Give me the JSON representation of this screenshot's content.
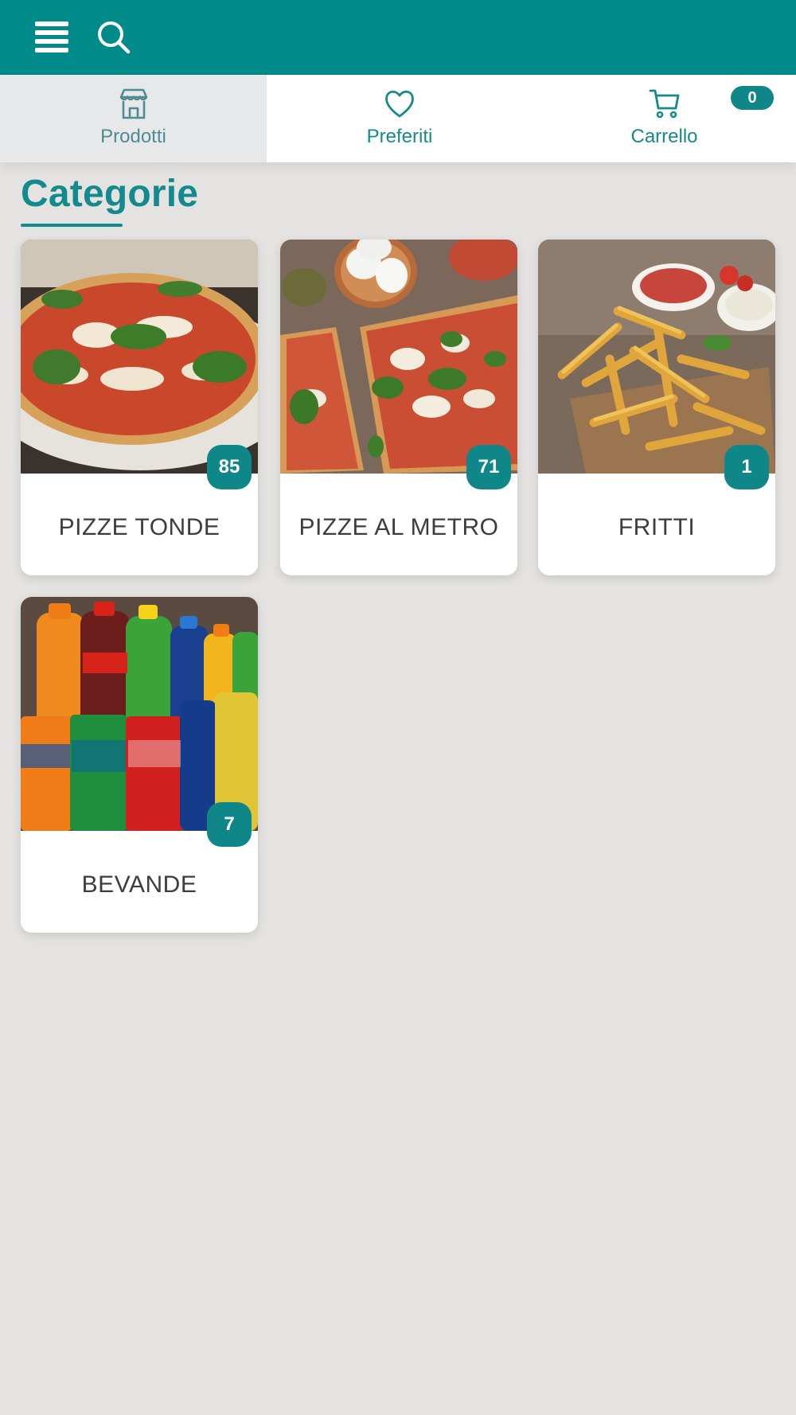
{
  "tabs": [
    {
      "label": "Prodotti",
      "icon": "store-icon"
    },
    {
      "label": "Preferiti",
      "icon": "heart-icon"
    },
    {
      "label": "Carrello",
      "icon": "cart-icon",
      "badge": "0"
    }
  ],
  "section": {
    "title": "Categorie"
  },
  "categories": [
    {
      "name": "PIZZE TONDE",
      "count": "85"
    },
    {
      "name": "PIZZE AL METRO",
      "count": "71"
    },
    {
      "name": "FRITTI",
      "count": "1"
    },
    {
      "name": "BEVANDE",
      "count": "7"
    }
  ],
  "colors": {
    "primary": "#008a8a",
    "badge": "#0f8788",
    "background": "#e4e3e2"
  }
}
